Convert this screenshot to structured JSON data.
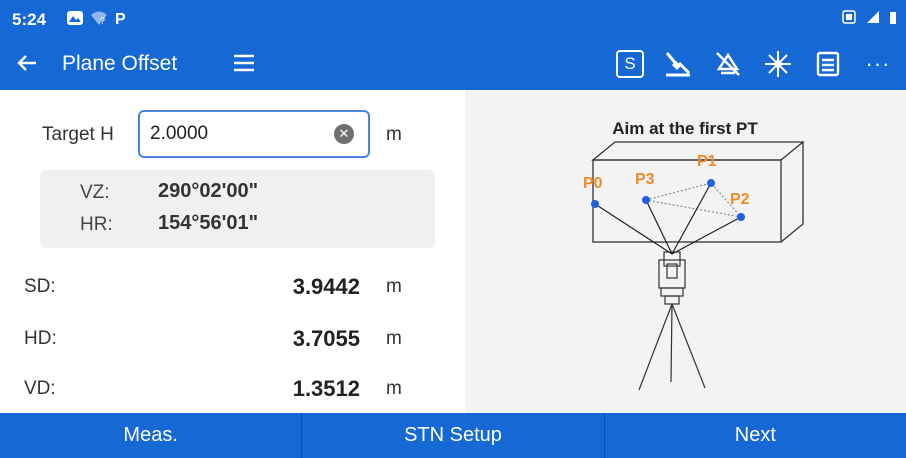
{
  "statusbar": {
    "time": "5:24"
  },
  "appbar": {
    "title": "Plane Offset",
    "s_label": "S",
    "more": "···"
  },
  "form": {
    "target_label": "Target H",
    "target_value": "2.0000",
    "target_unit": "m",
    "vz_label": "VZ:",
    "vz_value": "290°02'00\"",
    "hr_label": "HR:",
    "hr_value": "154°56'01\"",
    "sd_label": "SD:",
    "sd_value": "3.9442",
    "sd_unit": "m",
    "hd_label": "HD:",
    "hd_value": "3.7055",
    "hd_unit": "m",
    "vd_label": "VD:",
    "vd_value": "1.3512",
    "vd_unit": "m"
  },
  "diagram": {
    "title": "Aim at the first PT",
    "points": [
      "P0",
      "P3",
      "P1",
      "P2"
    ],
    "point_color": "#1f62e0",
    "label_color": "#f08a2a"
  },
  "bottom": {
    "meas": "Meas.",
    "stn_setup": "STN Setup",
    "next": "Next"
  },
  "colors": {
    "primary": "#1668d4"
  }
}
